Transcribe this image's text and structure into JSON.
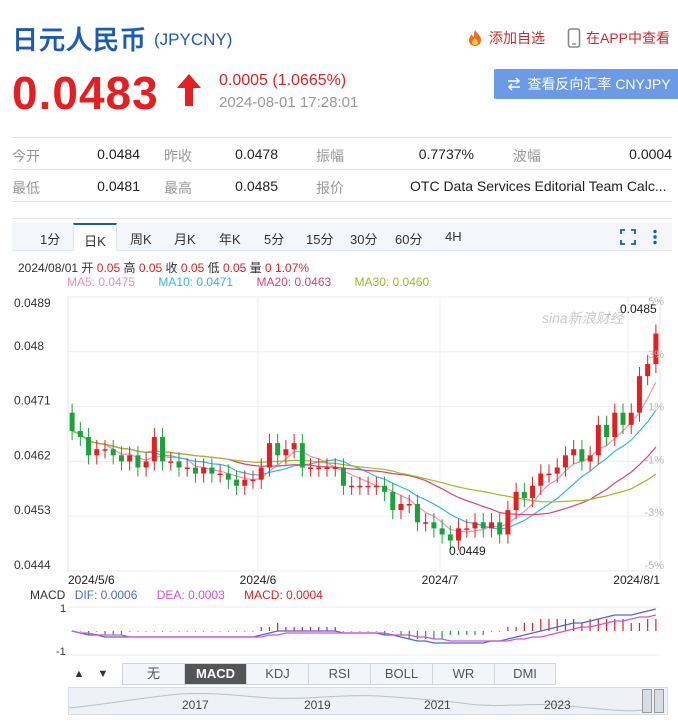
{
  "header": {
    "title": "日元人民币",
    "code": "(JPYCNY)",
    "add_favorite": "添加自选",
    "view_in_app": "在APP中查看"
  },
  "quote": {
    "price": "0.0483",
    "change": "0.0005 (1.0665%)",
    "time": "2024-08-01 17:28:01",
    "reverse_button": "查看反向汇率 CNYJPY"
  },
  "stats": {
    "open_label": "今开",
    "open": "0.0484",
    "prev_close_label": "昨收",
    "prev_close": "0.0478",
    "amplitude_label": "振幅",
    "amplitude": "0.7737%",
    "wave_label": "波幅",
    "wave": "0.0004",
    "low_label": "最低",
    "low": "0.0481",
    "high_label": "最高",
    "high": "0.0485",
    "quote_label": "报价",
    "quote_source": "OTC Data Services Editorial Team Calc..."
  },
  "chart_tabs": [
    "1分",
    "日K",
    "周K",
    "月K",
    "年K",
    "5分",
    "15分",
    "30分",
    "60分",
    "4H"
  ],
  "active_tab": "日K",
  "bar_info": {
    "date": "2024/08/01",
    "open_label": "开",
    "open": "0.05",
    "high_label": "高",
    "high": "0.05",
    "close_label": "收",
    "close": "0.05",
    "low_label": "低",
    "low": "0.05",
    "volume_label": "量",
    "volume": "0",
    "pct": "1.07%"
  },
  "ma_legend": {
    "ma5": "MA5: 0.0475",
    "ma10": "MA10: 0.0471",
    "ma20": "MA20: 0.0463",
    "ma30": "MA30: 0.0460"
  },
  "colors": {
    "up": "#e41e21",
    "down": "#17a43b",
    "ma5": "#f48fb1",
    "ma10": "#2fb8e6",
    "ma20": "#e0407a",
    "ma30": "#9cbb2a",
    "dif": "#4a67d6",
    "dea": "#d94fd9",
    "brand": "#1b5bb5"
  },
  "watermark": "sina新浪财经",
  "macd_legend": {
    "name": "MACD",
    "dif": "DIF: 0.0006",
    "dea": "DEA: 0.0003",
    "macd": "MACD: 0.0004"
  },
  "macd_axis": [
    "1",
    "-1"
  ],
  "indicator_tabs": [
    "无",
    "MACD",
    "KDJ",
    "RSI",
    "BOLL",
    "WR",
    "DMI"
  ],
  "active_indicator": "MACD",
  "nav_arrows": [
    "▲",
    "▼"
  ],
  "navigator_years": [
    "2017",
    "2019",
    "2021",
    "2023"
  ],
  "chart_data": {
    "type": "candlestick",
    "y_ticks": [
      "0.0489",
      "0.048",
      "0.0471",
      "0.0462",
      "0.0453",
      "0.0444"
    ],
    "ylim": [
      0.0444,
      0.0489
    ],
    "pct_ticks": [
      "5%",
      "3%",
      "1%",
      "-1%",
      "-3%",
      "-5%"
    ],
    "x_ticks": [
      "2024/5/6",
      "2024/6",
      "2024/7",
      "2024/8/1"
    ],
    "annotations": {
      "max_label": "0.0485",
      "min_label": "0.0449"
    },
    "closes": [
      0.0467,
      0.0466,
      0.0463,
      0.0464,
      0.0464,
      0.0463,
      0.0462,
      0.0463,
      0.0461,
      0.0462,
      0.0466,
      0.0462,
      0.0462,
      0.0461,
      0.0461,
      0.046,
      0.0461,
      0.046,
      0.046,
      0.0459,
      0.0458,
      0.0459,
      0.0459,
      0.0461,
      0.0465,
      0.0463,
      0.0464,
      0.0465,
      0.0461,
      0.0461,
      0.0461,
      0.0461,
      0.0461,
      0.0458,
      0.0458,
      0.0458,
      0.0458,
      0.0458,
      0.0457,
      0.0454,
      0.0455,
      0.0455,
      0.0452,
      0.0452,
      0.0451,
      0.045,
      0.0449,
      0.0451,
      0.0451,
      0.0452,
      0.0451,
      0.0452,
      0.045,
      0.0454,
      0.0457,
      0.0456,
      0.0458,
      0.046,
      0.046,
      0.0461,
      0.0463,
      0.0464,
      0.0462,
      0.0463,
      0.0468,
      0.0466,
      0.047,
      0.0468,
      0.047,
      0.0476,
      0.0478,
      0.0483
    ],
    "macd_dif": [
      0.0,
      -0.1,
      -0.2,
      -0.2,
      -0.3,
      -0.3,
      -0.3,
      -0.3,
      -0.3,
      -0.3,
      -0.3,
      -0.3,
      -0.3,
      -0.3,
      -0.3,
      -0.3,
      -0.3,
      -0.3,
      -0.3,
      -0.3,
      -0.3,
      -0.3,
      -0.3,
      -0.2,
      -0.1,
      0.0,
      0.0,
      0.0,
      0.0,
      0.0,
      0.0,
      0.0,
      0.0,
      -0.1,
      -0.1,
      -0.1,
      -0.1,
      -0.1,
      -0.2,
      -0.2,
      -0.3,
      -0.4,
      -0.5,
      -0.5,
      -0.6,
      -0.6,
      -0.6,
      -0.6,
      -0.6,
      -0.6,
      -0.6,
      -0.5,
      -0.5,
      -0.4,
      -0.3,
      -0.2,
      -0.1,
      0.0,
      0.1,
      0.2,
      0.3,
      0.4,
      0.4,
      0.5,
      0.6,
      0.7,
      0.8,
      0.8,
      0.8,
      0.9,
      1.0,
      1.1
    ],
    "macd_dea": [
      0.0,
      -0.1,
      -0.1,
      -0.2,
      -0.2,
      -0.2,
      -0.2,
      -0.3,
      -0.3,
      -0.3,
      -0.3,
      -0.3,
      -0.3,
      -0.3,
      -0.3,
      -0.3,
      -0.3,
      -0.3,
      -0.3,
      -0.3,
      -0.3,
      -0.3,
      -0.3,
      -0.3,
      -0.2,
      -0.2,
      -0.1,
      -0.1,
      -0.1,
      -0.1,
      -0.1,
      -0.1,
      -0.1,
      -0.1,
      -0.1,
      -0.1,
      -0.1,
      -0.1,
      -0.1,
      -0.2,
      -0.2,
      -0.2,
      -0.3,
      -0.3,
      -0.4,
      -0.4,
      -0.5,
      -0.5,
      -0.5,
      -0.5,
      -0.5,
      -0.5,
      -0.5,
      -0.5,
      -0.4,
      -0.4,
      -0.3,
      -0.3,
      -0.2,
      -0.1,
      0.0,
      0.1,
      0.2,
      0.2,
      0.3,
      0.4,
      0.5,
      0.5,
      0.6,
      0.7,
      0.7,
      0.8
    ]
  }
}
